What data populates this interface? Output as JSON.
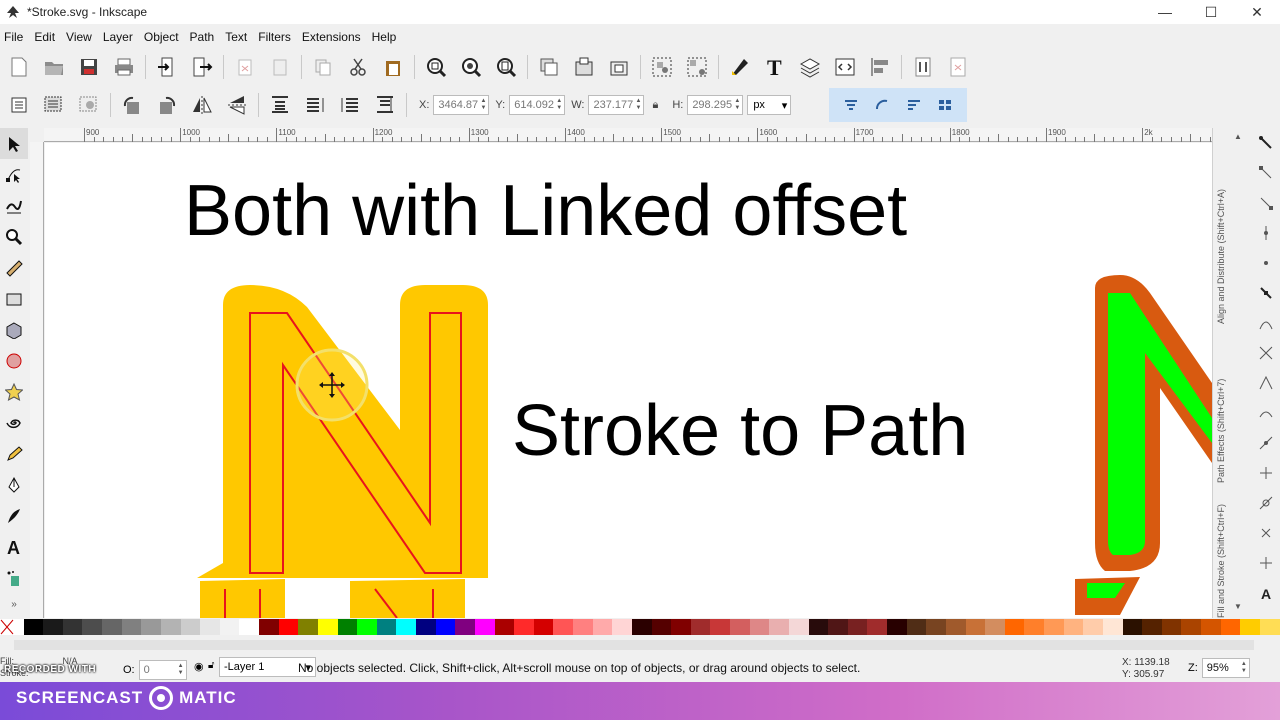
{
  "window": {
    "title": "*Stroke.svg - Inkscape",
    "min_glyph": "—",
    "max_glyph": "☐",
    "close_glyph": "✕"
  },
  "menu": [
    {
      "label": "File"
    },
    {
      "label": "Edit"
    },
    {
      "label": "View"
    },
    {
      "label": "Layer"
    },
    {
      "label": "Object"
    },
    {
      "label": "Path"
    },
    {
      "label": "Text"
    },
    {
      "label": "Filters"
    },
    {
      "label": "Extensions"
    },
    {
      "label": "Help"
    }
  ],
  "toolcontrols": {
    "x_label": "X:",
    "x_value": "3464.87",
    "y_label": "Y:",
    "y_value": "614.092",
    "w_label": "W:",
    "w_value": "237.177",
    "h_label": "H:",
    "h_value": "298.295",
    "unit": "px"
  },
  "ruler": {
    "labels": [
      "900",
      "1000",
      "1100",
      "1200",
      "1300",
      "1400",
      "1500",
      "1600",
      "1700",
      "1800",
      "1900",
      "2k"
    ]
  },
  "canvas": {
    "heading1": "Both with Linked offset",
    "heading2": "Stroke to Path",
    "colors": {
      "orange_fill": "#ffc800",
      "red_line": "#e8141c",
      "green": "#00ff00",
      "dark_orange": "#d85a10"
    }
  },
  "docks": {
    "align": "Align and Distribute (Shift+Ctrl+A)",
    "effects": "Path Effects (Shift+Ctrl+7)",
    "fill": "Fill and Stroke (Shift+Ctrl+F)"
  },
  "palette": [
    "#000000",
    "#1a1a1a",
    "#333333",
    "#4d4d4d",
    "#666666",
    "#808080",
    "#999999",
    "#b3b3b3",
    "#cccccc",
    "#e6e6e6",
    "#f2f2f2",
    "#ffffff",
    "#800000",
    "#ff0000",
    "#808000",
    "#ffff00",
    "#008000",
    "#00ff00",
    "#008080",
    "#00ffff",
    "#000080",
    "#0000ff",
    "#800080",
    "#ff00ff",
    "#aa0000",
    "#ff2a2a",
    "#d40000",
    "#ff5555",
    "#ff8080",
    "#ffaaaa",
    "#ffd5d5",
    "#2b0000",
    "#550000",
    "#800000",
    "#a02c2c",
    "#c83737",
    "#d35f5f",
    "#de8787",
    "#e9afaf",
    "#f4d7d7",
    "#280b0b",
    "#501616",
    "#782121",
    "#a02c2c",
    "#280000",
    "#502d16",
    "#784421",
    "#a05a2c",
    "#c87137",
    "#d38d5f",
    "#ff6600",
    "#ff7f2a",
    "#ff9955",
    "#ffb380",
    "#ffccaa",
    "#ffe6d5",
    "#2b1100",
    "#552200",
    "#803300",
    "#aa4400",
    "#d45500",
    "#ff6600",
    "#ffcc00",
    "#ffdd55"
  ],
  "status": {
    "fill_label": "Fill:",
    "fill_value": "N/A",
    "stroke_label": "Stroke:",
    "opacity_label": "O:",
    "opacity_value": "0",
    "layer": "-Layer 1",
    "message": "No objects selected. Click, Shift+click, Alt+scroll mouse on top of objects, or drag around objects to select.",
    "x_coord": "X: 1139.18",
    "y_coord": "Y:  305.97",
    "zoom_label": "Z:",
    "zoom": "95%"
  },
  "recorder": {
    "small": "RECORDED WITH",
    "brand_left": "SCREENCAST",
    "brand_right": "MATIC"
  }
}
